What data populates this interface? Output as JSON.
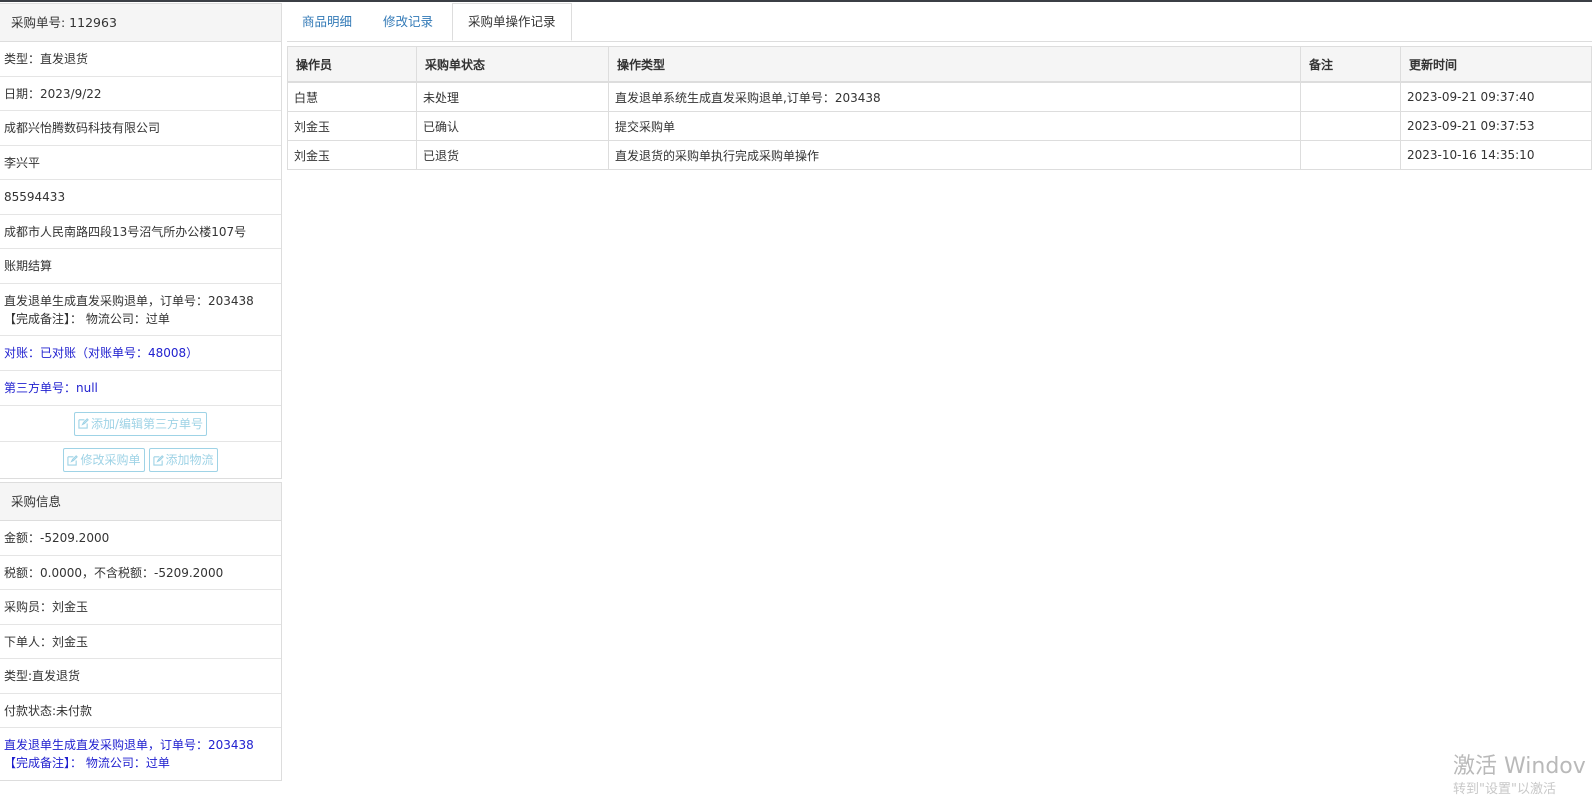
{
  "order_panel": {
    "header": "采购单号: 112963",
    "rows": {
      "type": "类型：直发退货",
      "date": "日期：2023/9/22",
      "company": "成都兴怡腾数码科技有限公司",
      "contact": "李兴平",
      "phone": "85594433",
      "address": "成都市人民南路四段13号沼气所办公楼107号",
      "settlement": "账期结算",
      "remark_line1": "直发退单生成直发采购退单，订单号：203438",
      "remark_line2": "【完成备注】： 物流公司：过单",
      "reconcile": "对账：已对账（对账单号：48008）",
      "third_party": "第三方单号：null"
    },
    "buttons": {
      "edit_third_party": "添加/编辑第三方单号",
      "edit_order": "修改采购单",
      "add_logistics": "添加物流"
    }
  },
  "purchase_panel": {
    "header": "采购信息",
    "rows": {
      "amount": "金额：-5209.2000",
      "tax": "税额：0.0000，不含税额：-5209.2000",
      "buyer": "采购员：刘金玉",
      "orderer": "下单人：刘金玉",
      "type": "类型:直发退货",
      "payment": "付款状态:未付款",
      "remark_line1": "直发退单生成直发采购退单，订单号：203438",
      "remark_line2": "【完成备注】： 物流公司：过单"
    }
  },
  "tabs": [
    "商品明细",
    "修改记录",
    "采购单操作记录"
  ],
  "table": {
    "headers": [
      "操作员",
      "采购单状态",
      "操作类型",
      "备注",
      "更新时间"
    ],
    "rows": [
      [
        "白慧",
        "未处理",
        "直发退单系统生成直发采购退单,订单号：203438",
        "",
        "2023-09-21 09:37:40"
      ],
      [
        "刘金玉",
        "已确认",
        "提交采购单",
        "",
        "2023-09-21 09:37:53"
      ],
      [
        "刘金玉",
        "已退货",
        "直发退货的采购单执行完成采购单操作",
        "",
        "2023-10-16 14:35:10"
      ]
    ]
  },
  "watermark": {
    "line1": "激活 Windov",
    "line2": "转到\"设置\"以激活"
  },
  "colors": {
    "link": "#337ab7",
    "blue_text": "#1f1fcf",
    "button_border": "#9fd3e6"
  }
}
